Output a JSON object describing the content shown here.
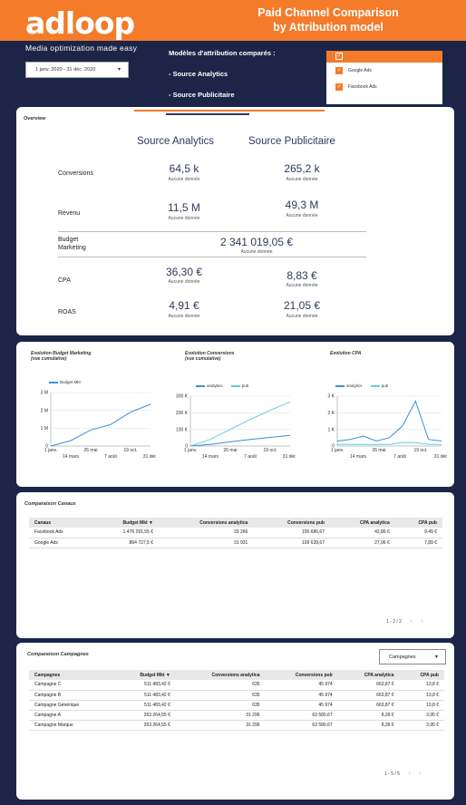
{
  "header": {
    "logo": "adloop",
    "tagline": "Media optimization made easy",
    "title_line1": "Paid Channel Comparison",
    "title_line2": "by Attribution model",
    "date_range": "1 janv. 2020 - 31 déc. 2020",
    "models_title": "Modèles d'attribution comparés :",
    "model_1": "- Source Analytics",
    "model_2": "- Source Publicitaire"
  },
  "filter": {
    "items": [
      "Google Ads",
      "Facebook Ads"
    ]
  },
  "overview": {
    "title": "Overview",
    "col1": "Source Analytics",
    "col2": "Source Publicitaire",
    "no_data": "Aucune donnée",
    "rows": {
      "conversions": {
        "label": "Conversions",
        "a": "64,5 k",
        "b": "265,2 k"
      },
      "revenu": {
        "label": "Revenu",
        "a": "11,5 M",
        "b": "49,3 M"
      },
      "budget": {
        "label1": "Budget",
        "label2": "Marketing",
        "value": "2 341 019,05 €"
      },
      "cpa": {
        "label": "CPA",
        "a": "36,30 €",
        "b": "8,83 €"
      },
      "roas": {
        "label": "ROAS",
        "a": "4,91 €",
        "b": "21,05 €"
      }
    }
  },
  "charts_card": {
    "budget": {
      "title1": "Evolution Budget Marketing",
      "title2": "(vue cumulative)",
      "legend": "Budget Mkt"
    },
    "conversions": {
      "title1": "Evolution Conversions",
      "title2": "(vue cumulative)",
      "legend_a": "analytics",
      "legend_b": "pub"
    },
    "cpa": {
      "title1": "Evolution CPA",
      "legend_a": "analytics",
      "legend_b": "pub"
    }
  },
  "chart_data": [
    {
      "type": "line",
      "title": "Evolution Budget Marketing (vue cumulative)",
      "x": [
        "1 janv.",
        "14 mars",
        "26 mai",
        "7 août",
        "19 oct.",
        "31 déc."
      ],
      "series": [
        {
          "name": "Budget Mkt",
          "values": [
            0,
            0.3,
            0.9,
            1.2,
            1.9,
            2.34
          ]
        }
      ],
      "yticks": [
        "0",
        "1 M",
        "2 M",
        "3 M"
      ],
      "ylim": [
        0,
        3
      ],
      "color": "#3b8fd9"
    },
    {
      "type": "line",
      "title": "Evolution Conversions (vue cumulative)",
      "x": [
        "1 janv.",
        "14 mars",
        "26 mai",
        "7 août",
        "19 oct.",
        "31 déc."
      ],
      "series": [
        {
          "name": "analytics",
          "values": [
            0,
            10,
            25,
            40,
            52,
            64.5
          ]
        },
        {
          "name": "pub",
          "values": [
            0,
            40,
            100,
            160,
            215,
            265
          ]
        }
      ],
      "yticks": [
        "0",
        "100 K",
        "200 K",
        "300 K"
      ],
      "ylim": [
        0,
        300
      ],
      "colors": [
        "#3b8fd9",
        "#5bd0e0"
      ]
    },
    {
      "type": "line",
      "title": "Evolution CPA",
      "x": [
        "1 janv.",
        "14 mars",
        "26 mai",
        "7 août",
        "19 oct.",
        "31 déc."
      ],
      "series": [
        {
          "name": "analytics",
          "values": [
            0.3,
            0.4,
            0.6,
            0.3,
            0.5,
            1.2,
            2.7,
            0.4,
            0.3
          ]
        },
        {
          "name": "pub",
          "values": [
            0.1,
            0.1,
            0.1,
            0.1,
            0.1,
            0.2,
            0.2,
            0.1,
            0.1
          ]
        }
      ],
      "yticks": [
        "0",
        "1 K",
        "2 K",
        "3 K"
      ],
      "ylim": [
        0,
        3
      ],
      "colors": [
        "#3b8fd9",
        "#5bd0e0"
      ]
    }
  ],
  "canaux": {
    "title": "Comparaison Canaux",
    "headers": [
      "Canaux",
      "Budget Mkt ▼",
      "Conversions analytica",
      "Conversions pub",
      "CPA analytica",
      "CPA pub"
    ],
    "rows": [
      [
        "Facebook Ads",
        "1 476 291,55 €",
        "33 266",
        "155 686,67",
        "42,86 €",
        "9,49 €"
      ],
      [
        "Google Ads",
        "864 727,5 €",
        "31 931",
        "109 639,67",
        "27,06 €",
        "7,89 €"
      ]
    ],
    "pager": "1 - 2 / 2"
  },
  "campagnes": {
    "title": "Comparaison Campagnes",
    "dropdown": "Campagnes",
    "headers": [
      "Campagnes",
      "Budget Mkt ▼",
      "Conversions analytica",
      "Conversions pub",
      "CPA analytica",
      "CPA pub"
    ],
    "rows": [
      [
        "Campagne C",
        "511 483,42 €",
        "635",
        "45 974",
        "663,87 €",
        "13,8 €"
      ],
      [
        "Campagne B",
        "511 483,42 €",
        "635",
        "45 974",
        "663,87 €",
        "13,8 €"
      ],
      [
        "Campagne Générique",
        "511 483,42 €",
        "635",
        "45 974",
        "663,87 €",
        "13,8 €"
      ],
      [
        "Campagne A",
        "353 264,55 €",
        "31 296",
        "63 580,67",
        "8,39 €",
        "3,95 €"
      ],
      [
        "Campagne Marque",
        "353 264,55 €",
        "31 296",
        "63 580,67",
        "8,39 €",
        "3,95 €"
      ]
    ],
    "pager": "1 - 5 / 5"
  }
}
